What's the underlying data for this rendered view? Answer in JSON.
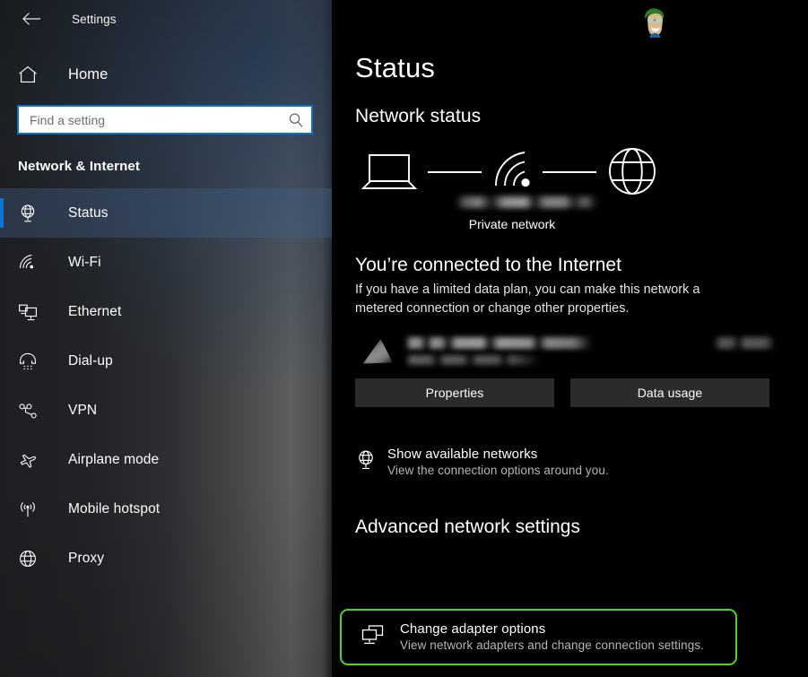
{
  "window": {
    "app_title": "Settings",
    "back_icon": "back-arrow-icon"
  },
  "sidebar": {
    "home": {
      "label": "Home",
      "icon": "home-icon"
    },
    "search": {
      "placeholder": "Find a setting",
      "value": "",
      "icon": "search-icon"
    },
    "category_heading": "Network & Internet",
    "items": [
      {
        "label": "Status",
        "icon": "network-status-icon",
        "selected": true
      },
      {
        "label": "Wi-Fi",
        "icon": "wifi-icon",
        "selected": false
      },
      {
        "label": "Ethernet",
        "icon": "ethernet-icon",
        "selected": false
      },
      {
        "label": "Dial-up",
        "icon": "dialup-phone-icon",
        "selected": false
      },
      {
        "label": "VPN",
        "icon": "vpn-icon",
        "selected": false
      },
      {
        "label": "Airplane mode",
        "icon": "airplane-icon",
        "selected": false
      },
      {
        "label": "Mobile hotspot",
        "icon": "hotspot-icon",
        "selected": false
      },
      {
        "label": "Proxy",
        "icon": "globe-icon",
        "selected": false
      }
    ]
  },
  "main": {
    "page_title": "Status",
    "network_status_heading": "Network status",
    "diagram": {
      "device_icon": "laptop-icon",
      "link_icon": "wifi-signal-icon",
      "internet_icon": "globe-icon",
      "network_name": "",
      "network_type": "Private network"
    },
    "connection": {
      "title": "You’re connected to the Internet",
      "description": "If you have a limited data plan, you can make this network a metered connection or change other properties."
    },
    "adapter_summary": {
      "name": "",
      "period": "",
      "usage": ""
    },
    "buttons": {
      "properties": "Properties",
      "data_usage": "Data usage"
    },
    "show_networks": {
      "icon": "network-status-icon",
      "title": "Show available networks",
      "subtitle": "View the connection options around you."
    },
    "advanced_heading": "Advanced network settings",
    "change_adapter": {
      "icon": "adapter-options-icon",
      "title": "Change adapter options",
      "subtitle": "View network adapters and change connection settings."
    }
  },
  "colors": {
    "accent_blue": "#0a75d4",
    "highlight_green": "#47d723",
    "main_bg": "#000000",
    "button_bg": "#2b2b2b"
  }
}
